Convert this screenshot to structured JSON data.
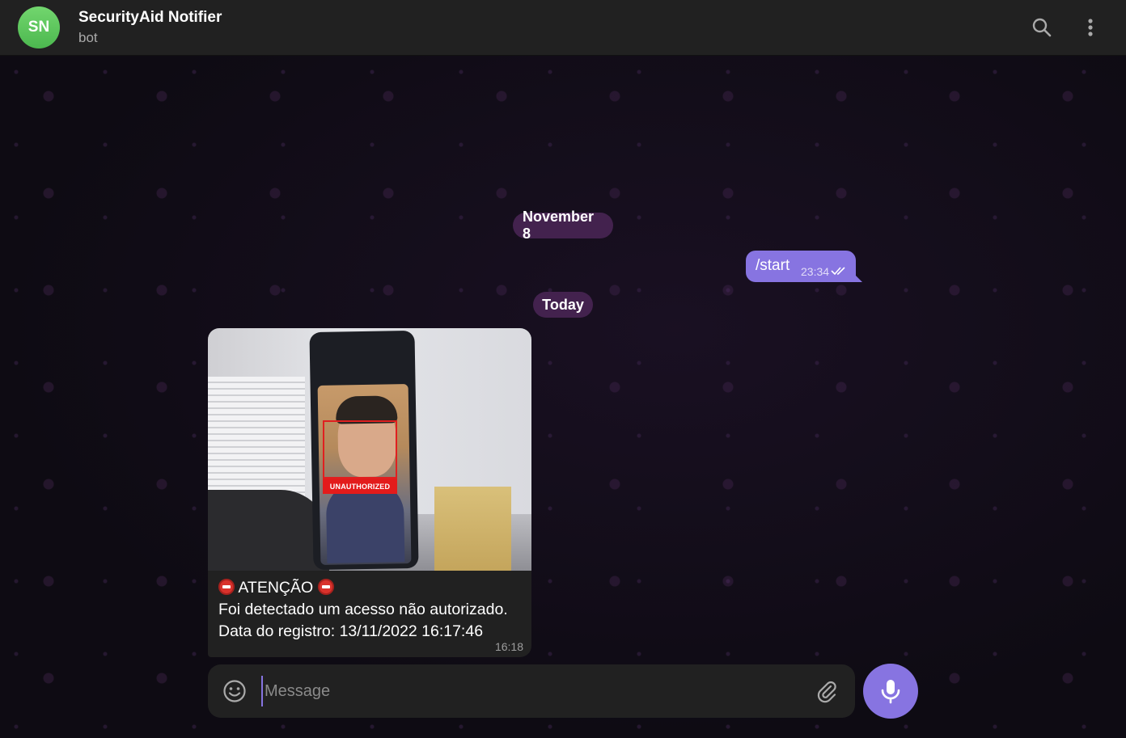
{
  "header": {
    "avatar_initials": "SN",
    "title": "SecurityAid Notifier",
    "status": "bot",
    "search_icon": "search-icon",
    "menu_icon": "more-vertical-icon"
  },
  "messages": {
    "date_1": "November 8",
    "outgoing_text": "/start",
    "outgoing_time": "23:34",
    "date_2": "Today",
    "incoming": {
      "photo_label": "UNAUTHORIZED",
      "line1": "ATENÇÃO",
      "line2": "Foi detectado um acesso não autorizado.",
      "line3": "Data do registro: 13/11/2022 16:17:46",
      "time": "16:18"
    }
  },
  "composer": {
    "placeholder": "Message",
    "emoji_icon": "emoji-icon",
    "attach_icon": "paperclip-icon",
    "mic_icon": "microphone-icon"
  },
  "colors": {
    "accent": "#8774e1",
    "header_bg": "#212121",
    "avatar": "#5cc65a",
    "alert_red": "#e31b1b"
  }
}
